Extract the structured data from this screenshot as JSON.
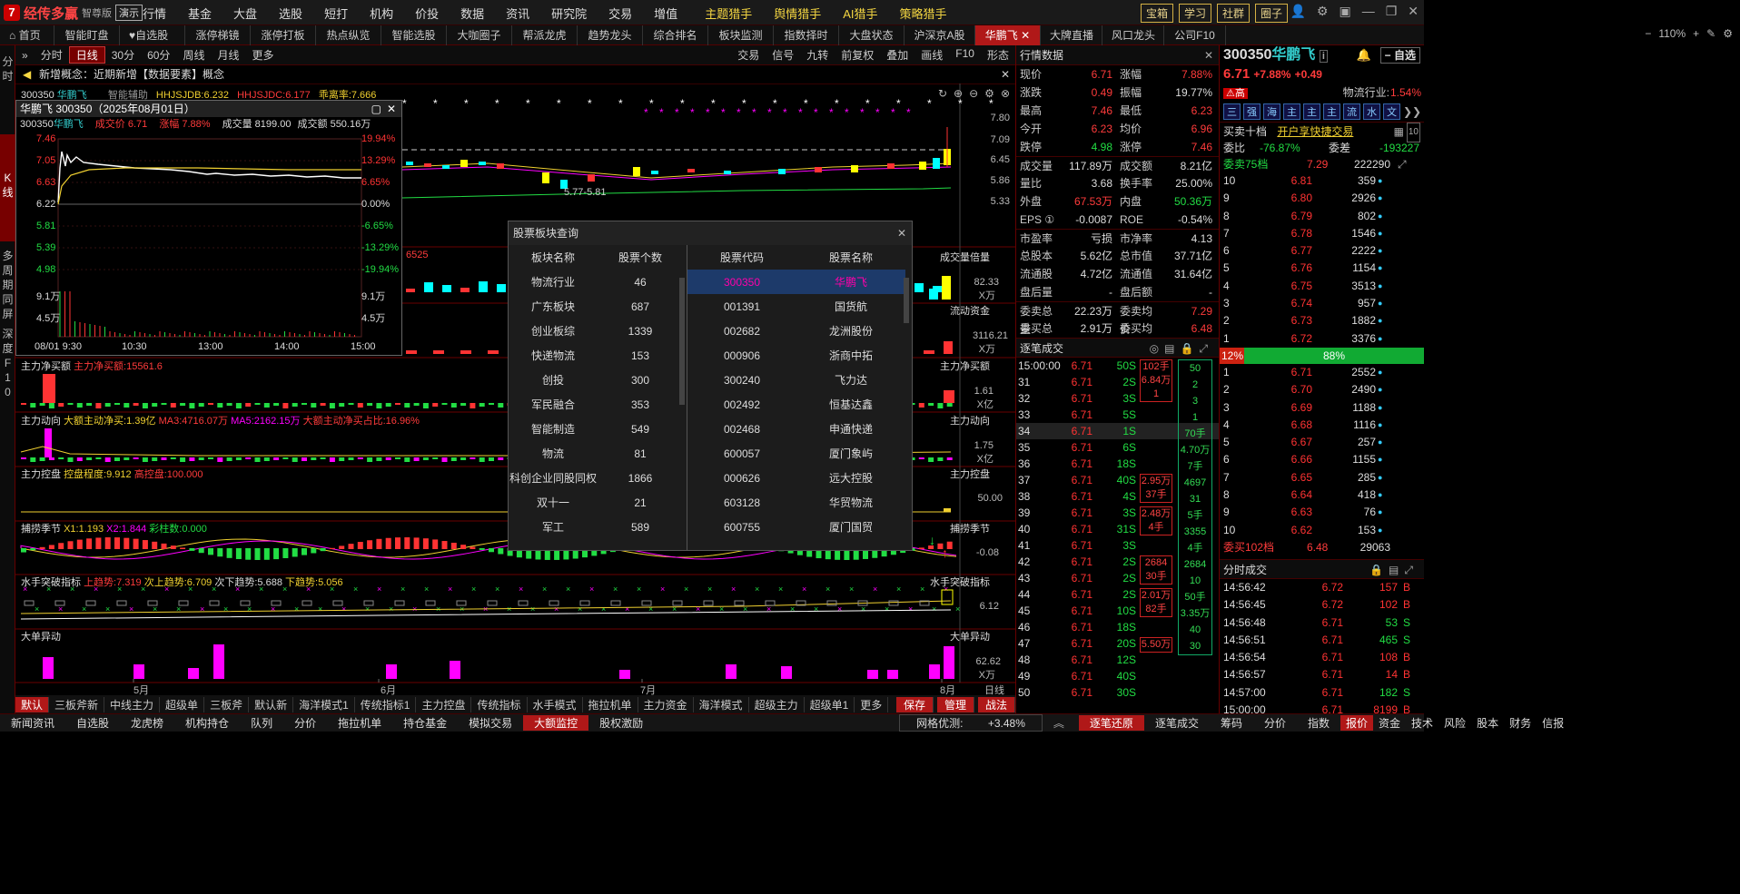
{
  "app": {
    "name": "经传多赢",
    "edition": "智尊版",
    "demo": "演示"
  },
  "menu": [
    "行情",
    "基金",
    "大盘",
    "选股",
    "短打",
    "机构",
    "价投",
    "数据",
    "资讯",
    "研究院",
    "交易",
    "增值"
  ],
  "menu_hunters": [
    "主题猎手",
    "舆情猎手",
    "AI猎手",
    "策略猎手"
  ],
  "top_buttons": [
    "宝箱",
    "学习",
    "社群",
    "圈子"
  ],
  "tabs": [
    "首页",
    "智能盯盘",
    "自选股",
    "涨停梯镜",
    "涨停打板",
    "热点纵览",
    "智能选股",
    "大咖圈子",
    "帮派龙虎",
    "趋势龙头",
    "综合排名",
    "板块监测",
    "指数择时",
    "大盘状态",
    "沪深京A股",
    "华鹏飞",
    "大牌直播",
    "风口龙头",
    "公司F10"
  ],
  "tab_zoom": "110%",
  "left_rail": [
    "分",
    "时",
    "K",
    "线",
    "多",
    "周",
    "期",
    "同",
    "屏",
    "深",
    "度",
    "F",
    "1",
    "0"
  ],
  "chart_toolbar": {
    "left": [
      "分时",
      "日线",
      "30分",
      "60分",
      "周线",
      "月线",
      "更多"
    ],
    "right": [
      "交易",
      "信号",
      "九转",
      "前复权",
      "叠加",
      "画线",
      "F10",
      "形态"
    ]
  },
  "notice": "新增概念：近期新增【数据要素】概念",
  "main_header": {
    "code": "300350",
    "name": "华鹏飞",
    "assist": "智能辅助",
    "i1": "HHJSJDB:6.232",
    "i2": "HHJSJDC:6.177",
    "i3": "乖离率:7.666"
  },
  "kline_axis": [
    "7.80",
    "7.09",
    "6.45",
    "5.86",
    "5.33"
  ],
  "kline_low_label": "5.77-5.81",
  "vol_label": "6525",
  "vol_axis": [
    "82.33",
    "X万"
  ],
  "vol_title": "成交量倍量",
  "fund_title": "流动资金",
  "fund_axis": [
    "3116.21",
    "X万"
  ],
  "panels": [
    {
      "title": "主力净买额",
      "ind": "主力净买额:15561.6",
      "axis1": "1.61",
      "axis2": "X亿",
      "rtitle": "主力净买额"
    },
    {
      "title": "主力动向",
      "ind": "大额主动净买:1.39亿",
      "ma3": "MA3:4716.07万",
      "ma5": "MA5:2162.15万",
      "ratio": "大额主动净买占比:16.96%",
      "axis1": "1.75",
      "axis2": "X亿",
      "rtitle": "主力动向"
    },
    {
      "title": "主力控盘",
      "ind": "控盘程度:9.912",
      "high": "高控盘:100.000",
      "axis1": "50.00",
      "rtitle": "主力控盘"
    },
    {
      "title": "捕捞季节",
      "x1": "X1:1.193",
      "x2": "X2:1.844",
      "cz": "彩柱数:0.000",
      "axis1": "-0.08",
      "rtitle": "捕捞季节"
    },
    {
      "title": "水手突破指标",
      "t1": "上趋势:7.319",
      "t2": "次上趋势:6.709",
      "t3": "次下趋势:5.688",
      "t4": "下趋势:5.056",
      "axis1": "6.12",
      "rtitle": "水手突破指标"
    },
    {
      "title": "大单异动",
      "axis1": "62.62",
      "axis2": "X万",
      "rtitle": "大单异动"
    }
  ],
  "month_labels": [
    "5月",
    "6月",
    "7月",
    "8月"
  ],
  "period_label": "日线",
  "bottom_tabs": [
    "默认",
    "三板斧新",
    "中线主力",
    "超级单",
    "三板斧",
    "默认新",
    "海洋模式1",
    "传统指标1",
    "主力控盘",
    "传统指标",
    "水手模式",
    "拖拉机单",
    "主力资金",
    "海洋模式",
    "超级主力",
    "超级单1",
    "更多"
  ],
  "bottom_right": [
    "保存",
    "管理",
    "战法"
  ],
  "status_bar": [
    "新闻资讯",
    "自选股",
    "龙虎榜",
    "机构持仓",
    "队列",
    "分价",
    "拖拉机单",
    "持仓基金",
    "模拟交易",
    "大额监控",
    "股权激励"
  ],
  "net_label": "网格优测:",
  "net_value": "+3.48%",
  "status_right": [
    "逐笔还原",
    "逐笔成交",
    "筹码",
    "分价",
    "指数"
  ],
  "status_far": [
    "报价",
    "资金",
    "技术",
    "风险",
    "股本",
    "财务",
    "信报"
  ],
  "minichart": {
    "title": "华鹏飞 300350（2025年08月01日）",
    "code": "300350",
    "name": "华鹏飞",
    "price_label": "成交价 6.71",
    "change_label": "涨幅 7.88%",
    "vol_label": "成交量 8199.00",
    "amt_label": "成交额 550.16万",
    "left_axis": [
      "7.46",
      "7.05",
      "6.63",
      "6.22",
      "5.81",
      "5.39",
      "4.98",
      "9.1万",
      "4.5万"
    ],
    "right_axis": [
      "19.94%",
      "13.29%",
      "6.65%",
      "0.00%",
      "-6.65%",
      "-13.29%",
      "-19.94%",
      "9.1万",
      "4.5万"
    ],
    "time_axis": [
      "08/01 9:30",
      "10:30",
      "13:00",
      "14:00",
      "15:00"
    ]
  },
  "popup": {
    "title": "股票板块查询",
    "h1": "板块名称",
    "h2": "股票个数",
    "h3": "股票代码",
    "h4": "股票名称",
    "sectors": [
      [
        "物流行业",
        "46"
      ],
      [
        "广东板块",
        "687"
      ],
      [
        "创业板综",
        "1339"
      ],
      [
        "快递物流",
        "153"
      ],
      [
        "创投",
        "300"
      ],
      [
        "军民融合",
        "353"
      ],
      [
        "智能制造",
        "549"
      ],
      [
        "物流",
        "81"
      ],
      [
        "科创企业同股同权",
        "1866"
      ],
      [
        "双十一",
        "21"
      ],
      [
        "军工",
        "589"
      ]
    ],
    "stocks": [
      [
        "300350",
        "华鹏飞"
      ],
      [
        "001391",
        "国货航"
      ],
      [
        "002682",
        "龙洲股份"
      ],
      [
        "000906",
        "浙商中拓"
      ],
      [
        "300240",
        "飞力达"
      ],
      [
        "002492",
        "恒基达鑫"
      ],
      [
        "002468",
        "申通快递"
      ],
      [
        "600057",
        "厦门象屿"
      ],
      [
        "000626",
        "远大控股"
      ],
      [
        "603128",
        "华贸物流"
      ],
      [
        "600755",
        "厦门国贸"
      ]
    ]
  },
  "quote": {
    "title": "行情数据",
    "rows": [
      [
        "现价",
        "6.71",
        "red",
        "涨幅",
        "7.88%",
        "red"
      ],
      [
        "涨跌",
        "0.49",
        "red",
        "振幅",
        "19.77%",
        "wht"
      ],
      [
        "最高",
        "7.46",
        "red",
        "最低",
        "6.23",
        "red"
      ],
      [
        "今开",
        "6.23",
        "red",
        "均价",
        "6.96",
        "red"
      ],
      [
        "跌停",
        "4.98",
        "grn",
        "涨停",
        "7.46",
        "red"
      ],
      [
        "成交量",
        "117.89万",
        "wht",
        "成交额",
        "8.21亿",
        "wht"
      ],
      [
        "量比",
        "3.68",
        "wht",
        "换手率",
        "25.00%",
        "wht"
      ],
      [
        "外盘",
        "67.53万",
        "red",
        "内盘",
        "50.36万",
        "grn"
      ],
      [
        "EPS ①",
        "-0.0087",
        "wht",
        "ROE",
        "-0.54%",
        "wht"
      ],
      [
        "市盈率",
        "亏损",
        "wht",
        "市净率",
        "4.13",
        "wht"
      ],
      [
        "总股本",
        "5.62亿",
        "wht",
        "总市值",
        "37.71亿",
        "wht"
      ],
      [
        "流通股",
        "4.72亿",
        "wht",
        "流通值",
        "31.64亿",
        "wht"
      ],
      [
        "盘后量",
        "-",
        "wht",
        "盘后额",
        "-",
        "wht"
      ],
      [
        "委卖总量",
        "22.23万",
        "wht",
        "委卖均价",
        "7.29",
        "red"
      ],
      [
        "委买总量",
        "2.91万",
        "wht",
        "委买均价",
        "6.48",
        "red"
      ]
    ],
    "ticks_title": "逐笔成交",
    "ticks": [
      [
        "15:00:00",
        "6.71",
        "50",
        "S"
      ],
      [
        "31",
        "6.71",
        "2",
        "S"
      ],
      [
        "32",
        "6.71",
        "3",
        "S"
      ],
      [
        "33",
        "6.71",
        "5",
        "S"
      ],
      [
        "34",
        "6.71",
        "1",
        "S"
      ],
      [
        "35",
        "6.71",
        "6",
        "S"
      ],
      [
        "36",
        "6.71",
        "18",
        "S"
      ],
      [
        "37",
        "6.71",
        "40",
        "S"
      ],
      [
        "38",
        "6.71",
        "4",
        "S"
      ],
      [
        "39",
        "6.71",
        "3",
        "S"
      ],
      [
        "40",
        "6.71",
        "31",
        "S"
      ],
      [
        "41",
        "6.71",
        "3",
        "S"
      ],
      [
        "42",
        "6.71",
        "2",
        "S"
      ],
      [
        "43",
        "6.71",
        "2",
        "S"
      ],
      [
        "44",
        "6.71",
        "2",
        "S"
      ],
      [
        "45",
        "6.71",
        "10",
        "S"
      ],
      [
        "46",
        "6.71",
        "18",
        "S"
      ],
      [
        "47",
        "6.71",
        "20",
        "S"
      ],
      [
        "48",
        "6.71",
        "12",
        "S"
      ],
      [
        "49",
        "6.71",
        "40",
        "S"
      ],
      [
        "50",
        "6.71",
        "30",
        "S"
      ]
    ],
    "agg_mid": [
      "102手",
      "6.84万",
      "1",
      "44手",
      "2.95万",
      "37手",
      "2.48万",
      "4手",
      "2684",
      "30手",
      "2.01万",
      "82手",
      "5.50万"
    ],
    "agg_right": [
      "50",
      "2",
      "3",
      "1",
      "70手",
      "4.70万",
      "7手",
      "4697",
      "31",
      "5手",
      "3355",
      "4手",
      "2684",
      "10",
      "50手",
      "3.35万",
      "40",
      "30"
    ]
  },
  "order": {
    "code": "300350",
    "name": "华鹏飞",
    "price": "6.71",
    "chg": "+7.88%",
    "diff": "+0.49",
    "tag": "高",
    "industry_label": "物流行业:",
    "industry_val": "1.54%",
    "add": "自选",
    "bar_icons": [
      "三",
      "强",
      "海",
      "主",
      "主",
      "主",
      "流",
      "水",
      "文"
    ],
    "l10": "买卖十档",
    "quick": "开户享快捷交易",
    "wb_label": "委比",
    "wb": "-76.87%",
    "wc_label": "委差",
    "wc": "-193227",
    "sell_label": "委卖75档",
    "sell_p": "7.29",
    "sell_v": "222290",
    "sells": [
      [
        "10",
        "6.81",
        "359"
      ],
      [
        "9",
        "6.80",
        "2926"
      ],
      [
        "8",
        "6.79",
        "802"
      ],
      [
        "7",
        "6.78",
        "1546"
      ],
      [
        "6",
        "6.77",
        "2222"
      ],
      [
        "5",
        "6.76",
        "1154"
      ],
      [
        "4",
        "6.75",
        "3513"
      ],
      [
        "3",
        "6.74",
        "957"
      ],
      [
        "2",
        "6.73",
        "1882"
      ],
      [
        "1",
        "6.72",
        "3376"
      ]
    ],
    "bar_left": "12%",
    "bar_mid": "88%",
    "buys": [
      [
        "1",
        "6.71",
        "2552"
      ],
      [
        "2",
        "6.70",
        "2490"
      ],
      [
        "3",
        "6.69",
        "1188"
      ],
      [
        "4",
        "6.68",
        "1116"
      ],
      [
        "5",
        "6.67",
        "257"
      ],
      [
        "6",
        "6.66",
        "1155"
      ],
      [
        "7",
        "6.65",
        "285"
      ],
      [
        "8",
        "6.64",
        "418"
      ],
      [
        "9",
        "6.63",
        "76"
      ],
      [
        "10",
        "6.62",
        "153"
      ]
    ],
    "buy_label": "委买102档",
    "buy_p": "6.48",
    "buy_v": "29063",
    "ts_title": "分时成交",
    "ts": [
      [
        "14:56:42",
        "6.72",
        "157",
        "B"
      ],
      [
        "14:56:45",
        "6.72",
        "102",
        "B"
      ],
      [
        "14:56:48",
        "6.71",
        "53",
        "S"
      ],
      [
        "14:56:51",
        "6.71",
        "465",
        "S"
      ],
      [
        "14:56:54",
        "6.71",
        "108",
        "B"
      ],
      [
        "14:56:57",
        "6.71",
        "14",
        "B"
      ],
      [
        "14:57:00",
        "6.71",
        "182",
        "S"
      ],
      [
        "15:00:00",
        "6.71",
        "8199",
        "B"
      ]
    ]
  }
}
